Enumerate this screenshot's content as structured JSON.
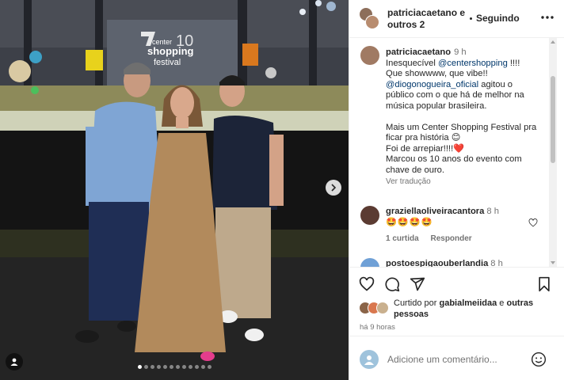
{
  "photo": {
    "stage_sign_line1": "center",
    "stage_sign_line2": "shopping",
    "stage_sign_line3": "festival",
    "stage_sign_number": "10",
    "carousel_total": 12,
    "carousel_active_index": 0,
    "icons": {
      "next": "chevron-right-icon",
      "tag": "user-tag-icon"
    }
  },
  "header": {
    "author_line1": "patriciacaetano e",
    "author_line2": "outros 2",
    "follow_label": "Seguindo",
    "more_icon": "more-horizontal-icon"
  },
  "caption": {
    "username": "patriciacaetano",
    "time": "9 h",
    "line1_start": "Inesquecível ",
    "line1_mention": "@centershopping",
    "line1_end": " !!!!",
    "line2": "Que showwww, que vibe!!",
    "line3_mention": "@diogonogueira_oficial",
    "line3_end": " agitou o",
    "line4": "público com o que há de melhor na",
    "line5": "música popular brasileira.",
    "line6": "Mais um Center Shopping Festival pra",
    "line7": "ficar pra história 😊",
    "line8": "Foi de arrepiar!!!!❤️",
    "line9": "Marcou os 10 anos do evento com",
    "line10": "chave de ouro.",
    "translate": "Ver tradução"
  },
  "comments": [
    {
      "username": "graziellaoliveiracantora",
      "time": "8 h",
      "text": "🤩🤩🤩🤩",
      "likes_label": "1 curtida",
      "reply_label": "Responder"
    },
    {
      "username": "postoespigaouberlandia",
      "time": "8 h"
    }
  ],
  "actions": {
    "icons": [
      "heart-icon",
      "comment-icon",
      "share-icon",
      "bookmark-icon"
    ],
    "liked_by_prefix": "Curtido por ",
    "liked_by_user": "gabialmeiidaa",
    "liked_by_suffix": " e ",
    "liked_by_others": "outras",
    "liked_by_others2": "pessoas",
    "time_ago": "há 9 horas"
  },
  "add_comment": {
    "placeholder": "Adicione um comentário...",
    "emoji_icon": "smiley-icon"
  },
  "colors": {
    "mention": "#00376b",
    "secondary_text": "#737373",
    "border": "#efefef"
  }
}
